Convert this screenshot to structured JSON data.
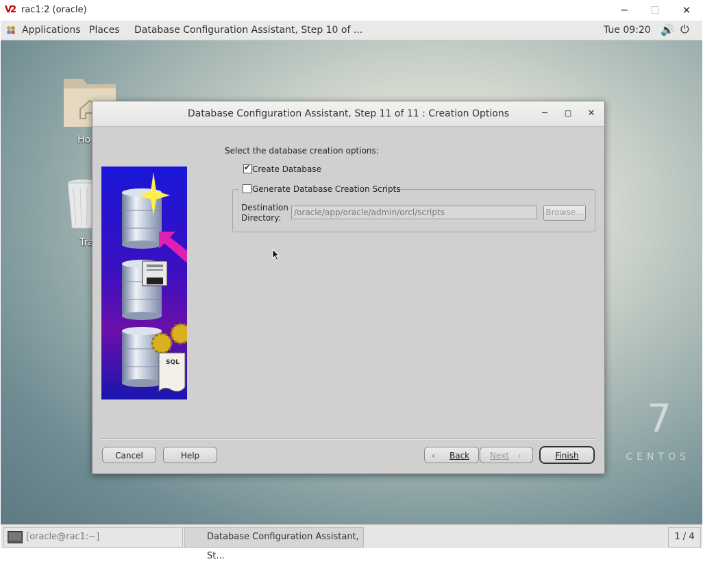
{
  "vnc": {
    "title": "rac1:2 (oracle)",
    "logo_text": "V2",
    "minimize": "─",
    "maximize": "☐",
    "close": "✕"
  },
  "topbar": {
    "applications": "Applications",
    "places": "Places",
    "active_window": "Database Configuration Assistant, Step 10 of ...",
    "clock": "Tue 09:20",
    "volume_icon": "🔊",
    "power_icon": "⏻"
  },
  "desktop": {
    "icons": [
      {
        "label": "Ho"
      },
      {
        "label": "Tra"
      }
    ],
    "brand_number": "7",
    "brand_word": "CENTOS"
  },
  "dialog": {
    "title": "Database Configuration Assistant, Step 11 of 11 : Creation Options",
    "minimize": "─",
    "maximize": "◻",
    "close": "✕",
    "prompt": "Select the database creation options:",
    "create_database": {
      "label": "Create Database",
      "checked": true
    },
    "generate_scripts": {
      "label": "Generate Database Creation Scripts",
      "checked": false
    },
    "destination_label_line1": "Destination",
    "destination_label_line2": "Directory:",
    "destination_value": "/oracle/app/oracle/admin/orcl/scripts",
    "browse": "Browse...",
    "buttons": {
      "cancel": "Cancel",
      "help": "Help",
      "back": "Back",
      "next": "Next",
      "finish": "Finish"
    },
    "art_text": "SQL"
  },
  "taskbar": {
    "terminal": "[oracle@rac1:~]",
    "dbca": "Database Configuration Assistant, St...",
    "workspace": "1 / 4"
  }
}
